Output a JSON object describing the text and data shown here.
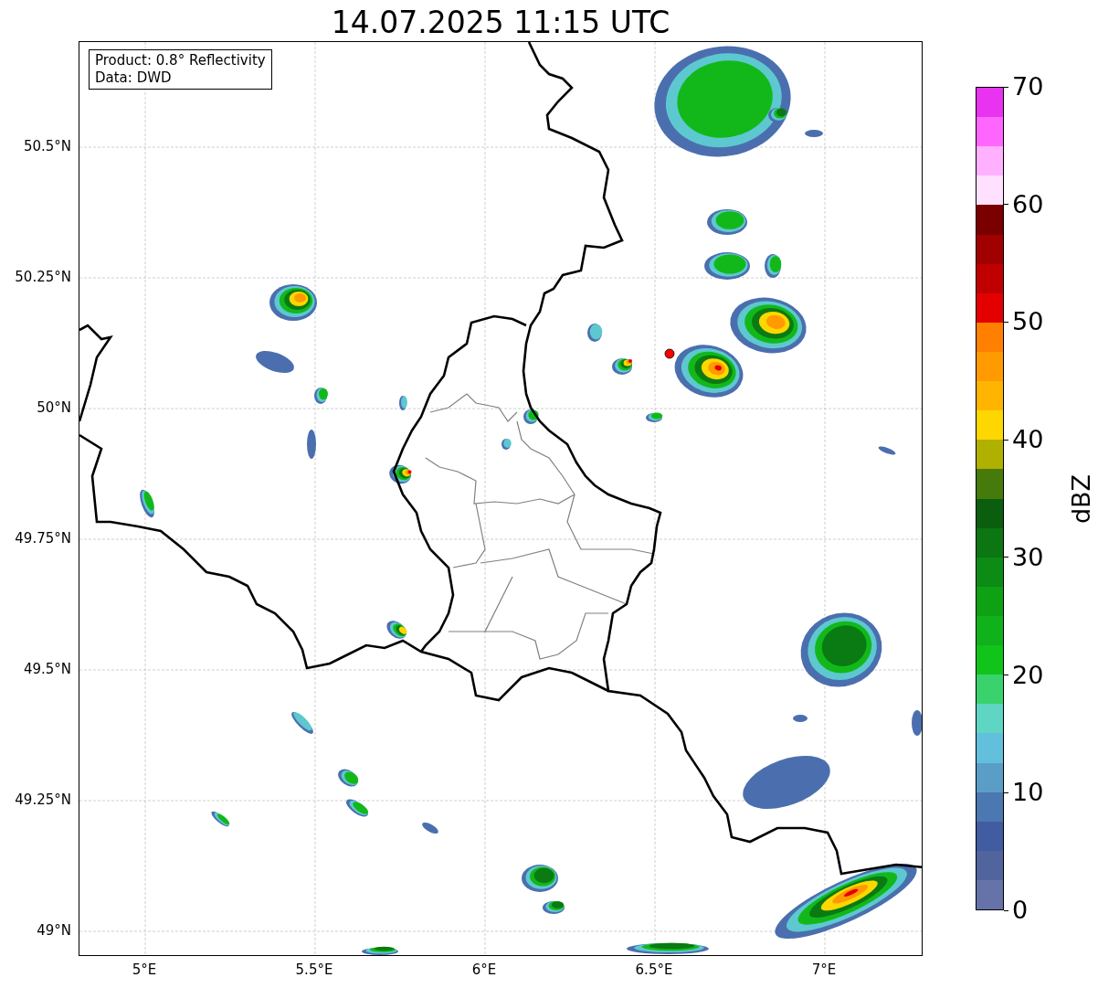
{
  "title": "14.07.2025 11:15 UTC",
  "info_box": [
    "Product: 0.8° Reflectivity",
    "Data: DWD"
  ],
  "map": {
    "lat_ticks": [
      "50.5°N",
      "50.25°N",
      "50°N",
      "49.75°N",
      "49.5°N",
      "49.25°N",
      "49°N"
    ],
    "lon_ticks": [
      "5°E",
      "5.5°E",
      "6°E",
      "6.5°E",
      "7°E"
    ]
  },
  "colorbar": {
    "label": "dBZ",
    "ticks": [
      "70",
      "60",
      "50",
      "40",
      "30",
      "20",
      "10",
      "0"
    ],
    "bins": [
      {
        "color": "#e833f0"
      },
      {
        "color": "#ff66ff"
      },
      {
        "color": "#ffb0ff"
      },
      {
        "color": "#ffe0ff"
      },
      {
        "color": "#7a0000"
      },
      {
        "color": "#a00000"
      },
      {
        "color": "#c00000"
      },
      {
        "color": "#e40000"
      },
      {
        "color": "#ff7f00"
      },
      {
        "color": "#ff9a00"
      },
      {
        "color": "#ffb400"
      },
      {
        "color": "#ffd700"
      },
      {
        "color": "#b0b000"
      },
      {
        "color": "#467a0a"
      },
      {
        "color": "#0a5e0e"
      },
      {
        "color": "#0b7612"
      },
      {
        "color": "#0c8c14"
      },
      {
        "color": "#0ea114"
      },
      {
        "color": "#0fb21a"
      },
      {
        "color": "#10c41a"
      },
      {
        "color": "#3ad26c"
      },
      {
        "color": "#5fd5c4"
      },
      {
        "color": "#63c0dc"
      },
      {
        "color": "#5a9ec8"
      },
      {
        "color": "#4b78b0"
      },
      {
        "color": "#415ca0"
      },
      {
        "color": "#52649e"
      },
      {
        "color": "#6673a8"
      }
    ]
  }
}
